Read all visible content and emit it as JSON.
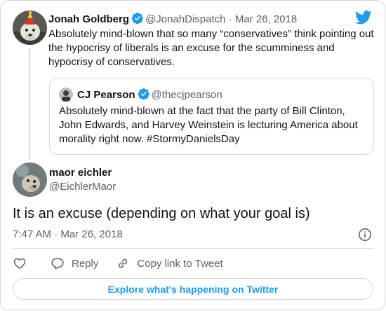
{
  "brand": {
    "accent": "#1d9bf0",
    "text": "#0f1419",
    "muted": "#536471",
    "border": "#cfd9de"
  },
  "parent_tweet": {
    "display_name": "Jonah Goldberg",
    "handle": "@JonahDispatch",
    "separator": "·",
    "date": "Mar 26, 2018",
    "text": "Absolutely mind-blown that so many “conservatives” think pointing out the hypocrisy of liberals is an excuse for the scumminess and hypocrisy of conservatives.",
    "verified": true,
    "avatar_icon": "dog-party-hat-avatar"
  },
  "quoted_tweet": {
    "display_name": "CJ Pearson",
    "handle": "@thecjpearson",
    "text": "Absolutely mind-blown at the fact that the party of Bill Clinton, John Edwards, and Harvey Weinstein is lecturing America about morality right now. #StormyDanielsDay",
    "verified": true,
    "avatar_icon": "person-avatar"
  },
  "reply_tweet": {
    "display_name": "maor eichler",
    "handle": "@EichlerMaor",
    "text": "It is an excuse (depending on what your goal is)",
    "time": "7:47 AM",
    "separator": "·",
    "date": "Mar 26, 2018",
    "avatar_icon": "dog-avatar"
  },
  "actions": {
    "like_icon": "heart-icon",
    "reply_label": "Reply",
    "copy_label": "Copy link to Tweet"
  },
  "explore_label": "Explore what's happening on Twitter"
}
